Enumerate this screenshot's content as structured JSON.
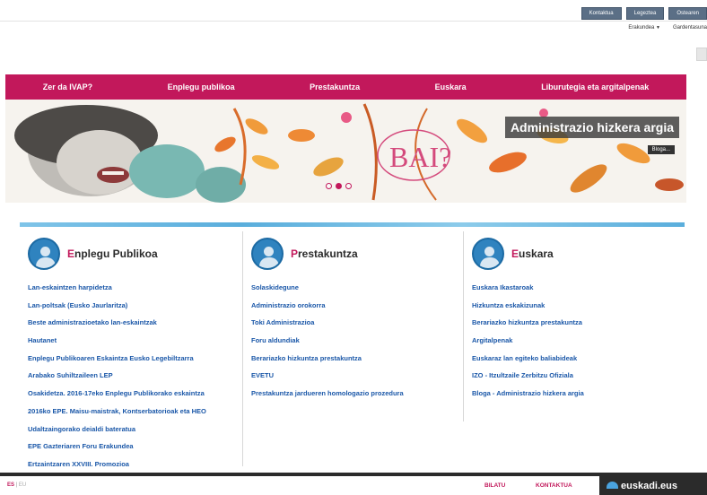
{
  "top_bar": {
    "buttons": [
      "Kontaktua",
      "Legeztea",
      "Ostearen"
    ],
    "links": [
      "Erakundea",
      "Gardentasuna"
    ]
  },
  "nav": {
    "items": [
      "Zer da IVAP?",
      "Enplegu publikoa",
      "Prestakuntza",
      "Euskara",
      "Liburutegia eta argitalpenak"
    ]
  },
  "banner": {
    "title": "Administrazio hizkera argia",
    "more_label": "Bloga...",
    "word": "BAI?",
    "slide_count": 3,
    "active_slide": 1
  },
  "columns": [
    {
      "title_first": "E",
      "title_rest": "nplegu Publikoa",
      "links": [
        "Lan-eskaintzen harpidetza",
        "Lan-poltsak (Eusko Jaurlaritza)",
        "Beste administrazioetako lan-eskaintzak",
        "Hautanet",
        "Enplegu Publikoaren Eskaintza Eusko Legebiltzarra",
        "Arabako Suhiltzaileen LEP",
        "Osakidetza. 2016-17eko Enplegu Publikorako eskaintza",
        "2016ko EPE. Maisu-maistrak, Kontserbatorioak eta HEO",
        "Udaltzaingorako deialdi bateratua",
        "EPE Gazteriaren Foru Erakundea",
        "Ertzaintzaren XXVIII. Promozioa"
      ]
    },
    {
      "title_first": "P",
      "title_rest": "restakuntza",
      "links": [
        "Solaskidegune",
        "Administrazio orokorra",
        "Toki Administrazioa",
        "Foru aldundiak",
        "Berariazko hizkuntza prestakuntza",
        "EVETU",
        "Prestakuntza jardueren homologazio prozedura"
      ]
    },
    {
      "title_first": "E",
      "title_rest": "uskara",
      "links": [
        "Euskara Ikastaroak",
        "Hizkuntza eskakizunak",
        "Berariazko hizkuntza prestakuntza",
        "Argitalpenak",
        "Euskaraz lan egiteko baliabideak",
        "IZO - Itzultzaile Zerbitzu Ofiziala",
        "Bloga - Administrazio hizkera argia"
      ]
    }
  ],
  "footer": {
    "lang_current": "ES",
    "lang_sep": "|",
    "lang_other": "EU",
    "search_label": "BILATU",
    "contact_label": "KONTAKTUA",
    "brand": "euskadi.eus"
  },
  "colors": {
    "accent": "#c2185b",
    "link": "#1a57a8",
    "icon_blue": "#2f83bf",
    "top_button": "#5b6f86",
    "footer_dark": "#2b2b2b"
  }
}
